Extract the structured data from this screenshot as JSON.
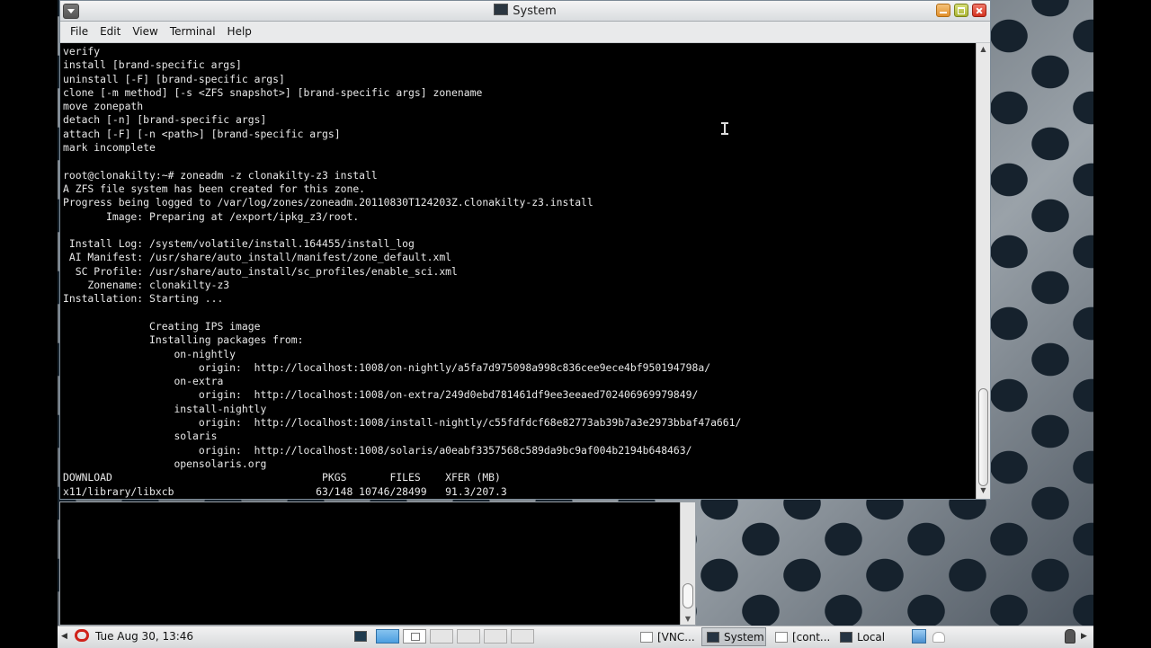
{
  "window": {
    "title": "System",
    "menu": [
      "File",
      "Edit",
      "View",
      "Terminal",
      "Help"
    ]
  },
  "terminal": {
    "lines": [
      "verify",
      "install [brand-specific args]",
      "uninstall [-F] [brand-specific args]",
      "clone [-m method] [-s <ZFS snapshot>] [brand-specific args] zonename",
      "move zonepath",
      "detach [-n] [brand-specific args]",
      "attach [-F] [-n <path>] [brand-specific args]",
      "mark incomplete",
      "",
      "root@clonakilty:~# zoneadm -z clonakilty-z3 install",
      "A ZFS file system has been created for this zone.",
      "Progress being logged to /var/log/zones/zoneadm.20110830T124203Z.clonakilty-z3.install",
      "       Image: Preparing at /export/ipkg_z3/root.",
      "",
      " Install Log: /system/volatile/install.164455/install_log",
      " AI Manifest: /usr/share/auto_install/manifest/zone_default.xml",
      "  SC Profile: /usr/share/auto_install/sc_profiles/enable_sci.xml",
      "    Zonename: clonakilty-z3",
      "Installation: Starting ...",
      "",
      "              Creating IPS image",
      "              Installing packages from:",
      "                  on-nightly",
      "                      origin:  http://localhost:1008/on-nightly/a5fa7d975098a998c836cee9ece4bf950194798a/",
      "                  on-extra",
      "                      origin:  http://localhost:1008/on-extra/249d0ebd781461df9ee3eeaed702406969979849/",
      "                  install-nightly",
      "                      origin:  http://localhost:1008/install-nightly/c55fdfdcf68e82773ab39b7a3e2973bbaf47a661/",
      "                  solaris",
      "                      origin:  http://localhost:1008/solaris/a0eabf3357568c589da9bc9af004b2194b648463/",
      "                  opensolaris.org",
      "DOWNLOAD                                  PKGS       FILES    XFER (MB)",
      "x11/library/libxcb                       63/148 10746/28499   91.3/207.3"
    ]
  },
  "taskbar": {
    "clock": "Tue Aug 30, 13:46",
    "tasks": [
      {
        "label": "[VNC..."
      },
      {
        "label": "System"
      },
      {
        "label": "[cont..."
      },
      {
        "label": "Local"
      }
    ]
  }
}
